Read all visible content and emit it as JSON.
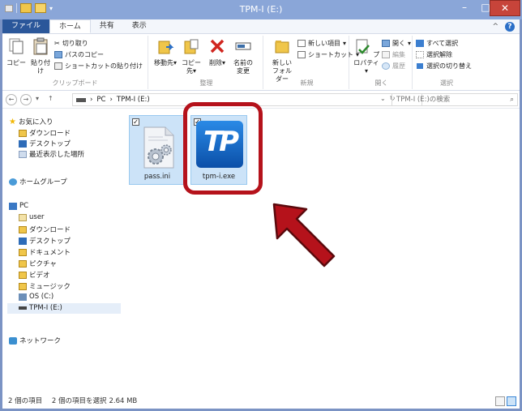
{
  "window": {
    "title": "TPM-I (E:)",
    "minimize_glyph": "–",
    "maximize_glyph": "□",
    "close_glyph": "✕"
  },
  "tabs": [
    {
      "label": "ファイル"
    },
    {
      "label": "ホーム"
    },
    {
      "label": "共有"
    },
    {
      "label": "表示"
    }
  ],
  "tabs_right": {
    "collapse_glyph": "^",
    "help_glyph": "?"
  },
  "ribbon": {
    "clipboard": {
      "copy": "コピー",
      "paste": "貼り付け",
      "cut": "切り取り",
      "copy_path": "パスのコピー",
      "paste_shortcut": "ショートカットの貼り付け",
      "label": "クリップボード"
    },
    "organize": {
      "move_to": "移動先",
      "copy_to": "コピー先",
      "delete": "削除",
      "rename_line1": "名前の",
      "rename_line2": "変更",
      "label": "整理"
    },
    "new": {
      "new_folder_line1": "新しい",
      "new_folder_line2": "フォルダー",
      "new_item": "新しい項目",
      "shortcut": "ショートカット",
      "label": "新規"
    },
    "open": {
      "properties": "プロパティ",
      "open": "開く",
      "edit": "編集",
      "history": "履歴",
      "label": "開く"
    },
    "select": {
      "select_all": "すべて選択",
      "select_none": "選択解除",
      "invert": "選択の切り替え",
      "label": "選択"
    }
  },
  "address": {
    "back_glyph": "←",
    "forward_glyph": "→",
    "recent_glyph": "▾",
    "up_glyph": "↑",
    "crumb_pc": "PC",
    "crumb_sep": "›",
    "crumb_drive": "TPM-I (E:)",
    "dropdown_glyph": "⌄",
    "refresh_glyph": "↻",
    "search_placeholder": "TPM-I (E:)の検索",
    "search_glyph": "⌕"
  },
  "nav": {
    "favorites": "お気に入り",
    "downloads": "ダウンロード",
    "desktop": "デスクトップ",
    "recent": "最近表示した場所",
    "homegroup": "ホームグループ",
    "pc": "PC",
    "user": "user",
    "pc_downloads": "ダウンロード",
    "pc_desktop": "デスクトップ",
    "documents": "ドキュメント",
    "pictures": "ピクチャ",
    "videos": "ビデオ",
    "music": "ミュージック",
    "os": "OS (C:)",
    "tpm": "TPM-I (E:)",
    "network": "ネットワーク"
  },
  "files": [
    {
      "name": "pass.ini",
      "checked": "✓"
    },
    {
      "name": "tpm-i.exe",
      "checked": "✓",
      "icon_text": "TP"
    }
  ],
  "status": {
    "count": "2 個の項目",
    "selected": "2 個の項目を選択",
    "size": "2.64 MB"
  },
  "colors": {
    "title_bar": "#8aa6d8",
    "file_tab": "#2b579a",
    "highlight": "#c0121b",
    "arrow_fill": "#b5121b",
    "tpm_icon": "#1c6fd1"
  }
}
